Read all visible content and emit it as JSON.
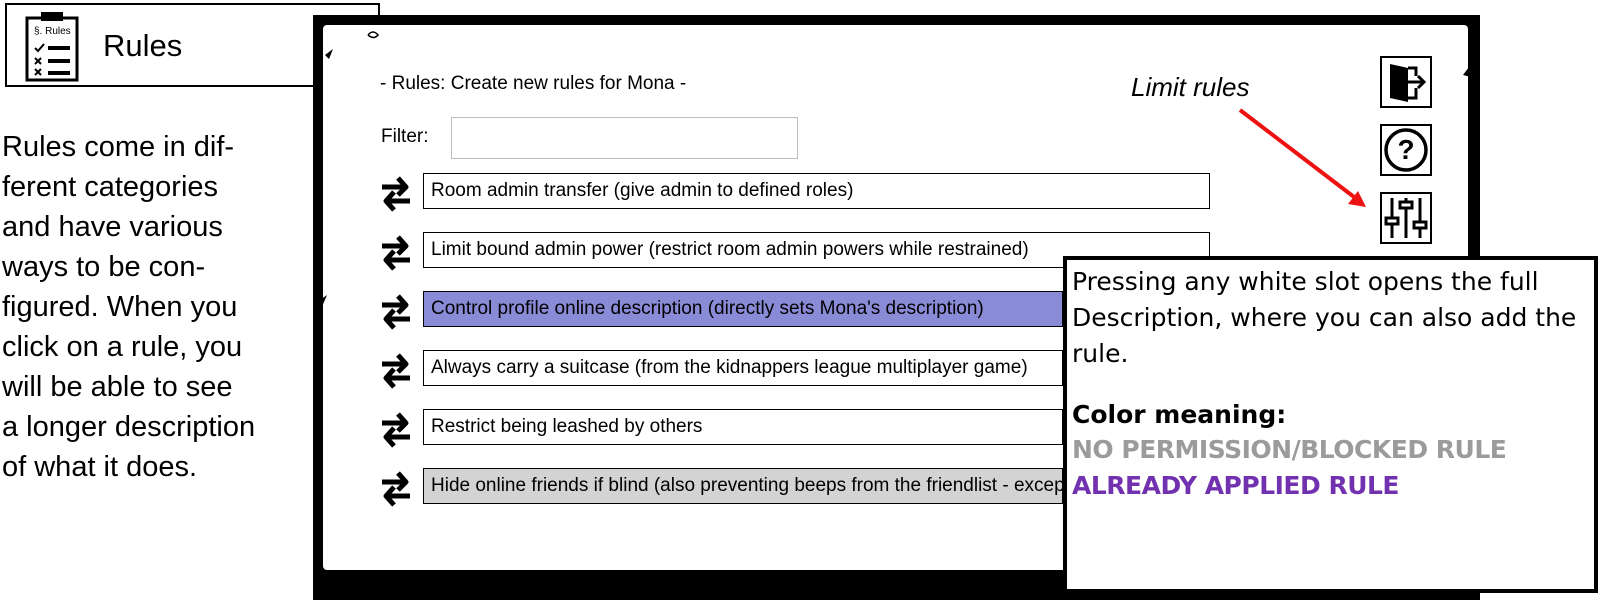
{
  "header": {
    "title": "Rules",
    "icon_label": "§. Rules"
  },
  "explanation": {
    "lines": [
      "Rules come in dif-",
      "ferent categories",
      "and have various",
      "ways to be con-",
      "figured. When you",
      "click on a rule, you",
      "will be able to see",
      "a longer description",
      "of what it does."
    ]
  },
  "screen": {
    "title": "- Rules: Create new rules for Mona -",
    "filter_label": "Filter:",
    "filter_value": "",
    "rules": [
      {
        "label": "Room admin transfer (give admin to defined roles)",
        "state": "normal"
      },
      {
        "label": "Limit bound admin power (restrict room admin powers while restrained)",
        "state": "normal"
      },
      {
        "label": "Control profile online description (directly sets Mona's description)",
        "state": "applied"
      },
      {
        "label": "Always carry a suitcase (from the kidnappers league multiplayer game)",
        "state": "normal"
      },
      {
        "label": "Restrict being leashed by others",
        "state": "normal"
      },
      {
        "label": "Hide online friends if blind (also preventing beeps from the friendlist - except from owner)",
        "state": "blocked"
      }
    ],
    "buttons": {
      "exit": "exit-icon",
      "help": "help-icon",
      "limit": "sliders-icon"
    }
  },
  "annotation": {
    "limit_label": "Limit rules",
    "arrow_color": "#ee1111"
  },
  "description_box": {
    "text": "Pressing any white slot opens the full Description, where you can also add the rule.",
    "color_heading": "Color meaning:",
    "blocked_label": "NO PERMISSION/BLOCKED RULE",
    "applied_label": "ALREADY APPLIED RULE"
  },
  "colors": {
    "applied": "#8a8bd7",
    "blocked": "#d3d3d3",
    "blocked_text": "#9b9b9b",
    "applied_text": "#7232b0"
  }
}
